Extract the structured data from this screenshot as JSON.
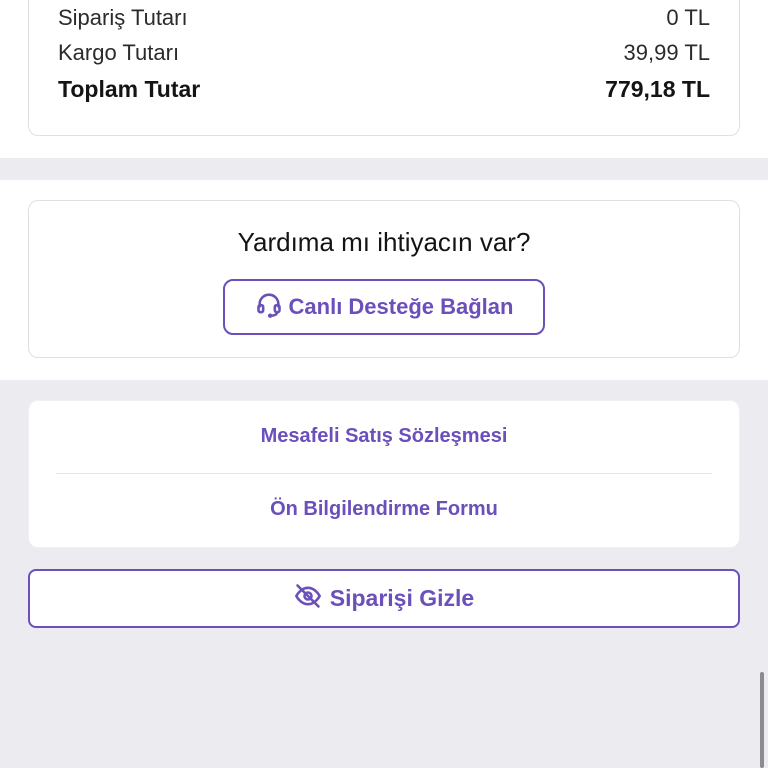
{
  "summary": {
    "rows": [
      {
        "label": "Sipariş Tutarı",
        "value": "0 TL"
      },
      {
        "label": "Kargo Tutarı",
        "value": "39,99 TL"
      },
      {
        "label": "Toplam Tutar",
        "value": "779,18 TL"
      }
    ]
  },
  "help": {
    "title": "Yardıma mı ihtiyacın var?",
    "button_label": "Canlı Desteğe Bağlan",
    "button_icon": "headset-icon"
  },
  "documents": {
    "links": [
      {
        "label": "Mesafeli Satış Sözleşmesi"
      },
      {
        "label": "Ön Bilgilendirme Formu"
      }
    ]
  },
  "hide_order": {
    "label": "Siparişi Gizle",
    "icon": "eye-slash-icon"
  },
  "colors": {
    "accent": "#6b4fbb",
    "background_gray": "#ececf0"
  }
}
